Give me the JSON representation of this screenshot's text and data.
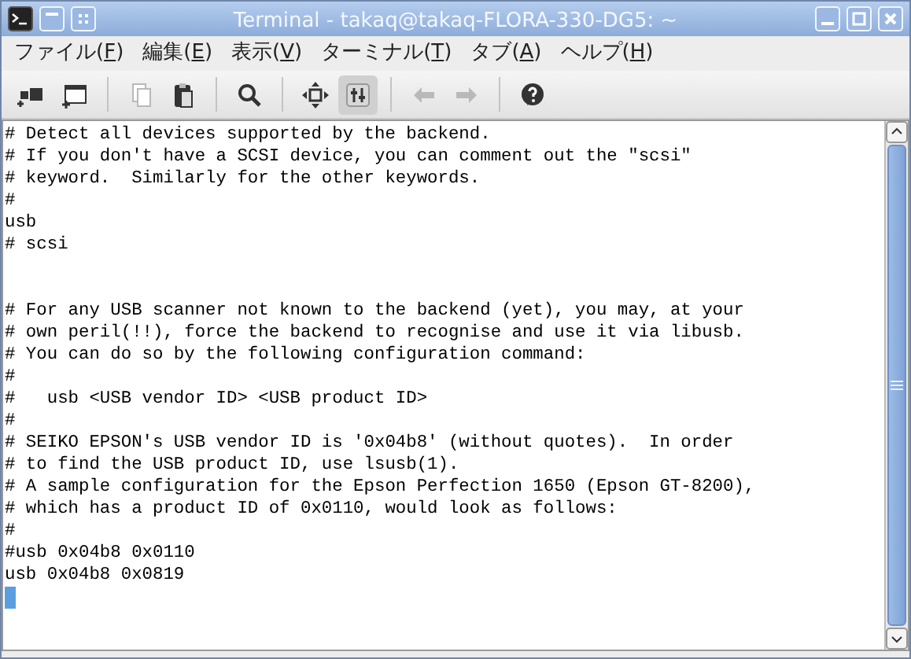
{
  "window": {
    "title": "Terminal - takaq@takaq-FLORA-330-DG5: ~"
  },
  "menu": [
    {
      "before": "ファイル(",
      "mnemonic": "F",
      "after": ")"
    },
    {
      "before": "編集(",
      "mnemonic": "E",
      "after": ")"
    },
    {
      "before": "表示(",
      "mnemonic": "V",
      "after": ")"
    },
    {
      "before": "ターミナル(",
      "mnemonic": "T",
      "after": ")"
    },
    {
      "before": "タブ(",
      "mnemonic": "A",
      "after": ")"
    },
    {
      "before": "ヘルプ(",
      "mnemonic": "H",
      "after": ")"
    }
  ],
  "toolbar": {
    "groups": [
      {
        "buttons": [
          {
            "disabled": false,
            "pressed": false
          },
          {
            "disabled": false,
            "pressed": false
          }
        ]
      },
      {
        "buttons": [
          {
            "disabled": true,
            "pressed": false
          },
          {
            "disabled": false,
            "pressed": false
          }
        ]
      },
      {
        "buttons": [
          {
            "disabled": false,
            "pressed": false
          }
        ]
      },
      {
        "buttons": [
          {
            "disabled": false,
            "pressed": false
          },
          {
            "disabled": false,
            "pressed": true
          }
        ]
      },
      {
        "buttons": [
          {
            "disabled": true,
            "pressed": false
          },
          {
            "disabled": true,
            "pressed": false
          }
        ]
      },
      {
        "buttons": [
          {
            "disabled": false,
            "pressed": false
          }
        ]
      }
    ]
  },
  "terminal": {
    "lines": [
      {
        "kind": "text",
        "text": "# Detect all devices supported by the backend."
      },
      {
        "kind": "text",
        "text": "# If you don't have a SCSI device, you can comment out the \"scsi\""
      },
      {
        "kind": "text",
        "text": "# keyword.  Similarly for the other keywords."
      },
      {
        "kind": "text",
        "text": "#"
      },
      {
        "kind": "text",
        "text": "usb"
      },
      {
        "kind": "text",
        "text": "# scsi"
      },
      {
        "kind": "blank"
      },
      {
        "kind": "blank"
      },
      {
        "kind": "text",
        "text": "# For any USB scanner not known to the backend (yet), you may, at your"
      },
      {
        "kind": "text",
        "text": "# own peril(!!), force the backend to recognise and use it via libusb."
      },
      {
        "kind": "text",
        "text": "# You can do so by the following configuration command:"
      },
      {
        "kind": "text",
        "text": "#"
      },
      {
        "kind": "text",
        "text": "#   usb <USB vendor ID> <USB product ID>"
      },
      {
        "kind": "text",
        "text": "#"
      },
      {
        "kind": "text",
        "text": "# SEIKO EPSON's USB vendor ID is '0x04b8' (without quotes).  In order"
      },
      {
        "kind": "text",
        "text": "# to find the USB product ID, use lsusb(1)."
      },
      {
        "kind": "text",
        "text": "# A sample configuration for the Epson Perfection 1650 (Epson GT-8200),"
      },
      {
        "kind": "text",
        "text": "# which has a product ID of 0x0110, would look as follows:"
      },
      {
        "kind": "text",
        "text": "#"
      },
      {
        "kind": "text",
        "text": "#usb 0x04b8 0x0110"
      },
      {
        "kind": "text",
        "text": "usb 0x04b8 0x0819"
      },
      {
        "kind": "cursor"
      }
    ]
  }
}
